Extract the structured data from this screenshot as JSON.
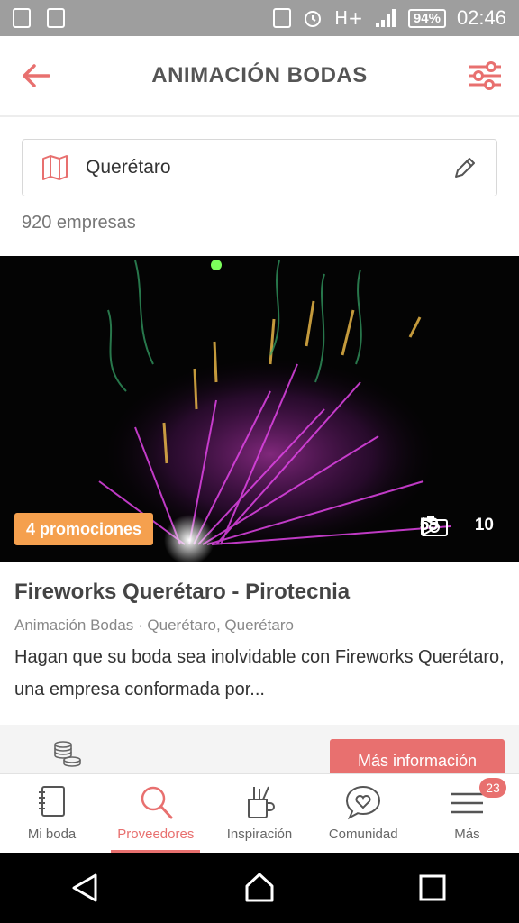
{
  "status_bar": {
    "network": "H+",
    "battery": "94%",
    "time": "02:46"
  },
  "header": {
    "title": "ANIMACIÓN BODAS",
    "back_icon": "arrow-left-icon",
    "filter_icon": "sliders-icon"
  },
  "location": {
    "value": "Querétaro",
    "map_icon": "map-icon",
    "edit_icon": "pencil-icon"
  },
  "results_count": "920 empresas",
  "listing": {
    "promo_badge": "4 promociones",
    "photo_count": "59",
    "video_count": "10",
    "title": "Fireworks Querétaro - Pirotecnia",
    "subtitle": "Animación Bodas · Querétaro, Querétaro",
    "description": "Hagan que su boda sea inolvidable con Fireworks Querétaro, una empresa conformada por...",
    "cta": "Más información"
  },
  "bottom_nav": {
    "items": [
      {
        "label": "Mi boda",
        "icon": "notebook-icon"
      },
      {
        "label": "Proveedores",
        "icon": "search-icon",
        "active": true
      },
      {
        "label": "Inspiración",
        "icon": "paint-brush-icon"
      },
      {
        "label": "Comunidad",
        "icon": "heart-chat-icon"
      },
      {
        "label": "Más",
        "icon": "menu-icon",
        "badge": "23"
      }
    ]
  },
  "colors": {
    "accent": "#e8706f",
    "promo": "#f5a04e",
    "status_bar": "#9e9e9e"
  }
}
